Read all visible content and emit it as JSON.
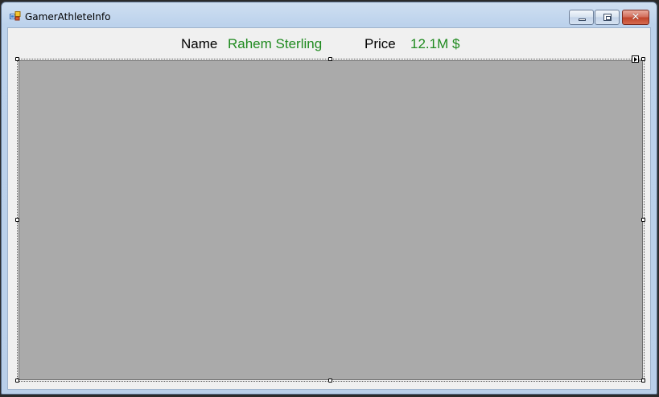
{
  "window": {
    "title": "GamerAthleteInfo",
    "app_icon": "forms-app-icon",
    "close_symbol": "✕"
  },
  "athlete": {
    "name_label": "Name",
    "name_value": "Rahem Sterling",
    "price_label": "Price",
    "price_value": "12.1M $"
  },
  "colors": {
    "value_text": "#1f8a1f",
    "picture_box": "#aaaaaa",
    "client_area": "#f0f0f0"
  }
}
